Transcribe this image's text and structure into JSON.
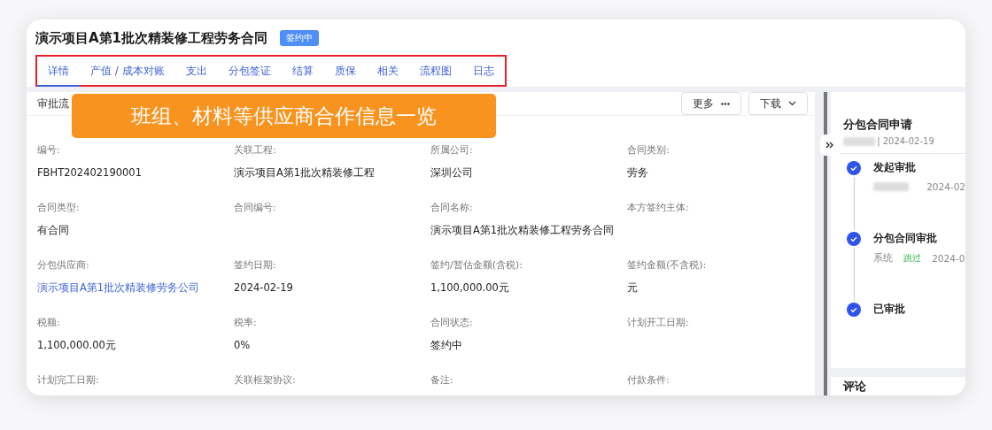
{
  "title": "演示项目A第1批次精装修工程劳务合同",
  "status_badge": "签约中",
  "tabs": [
    {
      "label": "详情",
      "selected": true
    },
    {
      "label": "产值 / 成本对账",
      "selected": false
    },
    {
      "label": "支出",
      "selected": false
    },
    {
      "label": "分包签证",
      "selected": false
    },
    {
      "label": "结算",
      "selected": false
    },
    {
      "label": "质保",
      "selected": false
    },
    {
      "label": "相关",
      "selected": false
    },
    {
      "label": "流程图",
      "selected": false
    },
    {
      "label": "日志",
      "selected": false
    }
  ],
  "panel": {
    "heading": "审批流",
    "buttons": [
      {
        "label": "更多",
        "kind": "more"
      },
      {
        "label": "下载",
        "kind": "dropdown"
      }
    ]
  },
  "fields": [
    {
      "label": "编号:",
      "value": "FBHT202402190001",
      "kind": "text"
    },
    {
      "label": "关联工程:",
      "value": "演示项目A第1批次精装修工程",
      "kind": "text"
    },
    {
      "label": "所属公司:",
      "value": "深圳公司",
      "kind": "text"
    },
    {
      "label": "合同类别:",
      "value": "劳务",
      "kind": "text"
    },
    {
      "label": "合同类型:",
      "value": "有合同",
      "kind": "text"
    },
    {
      "label": "合同编号:"
    },
    {
      "label": "合同名称:",
      "value": "演示项目A第1批次精装修工程劳务合同",
      "kind": "text"
    },
    {
      "label": "本方签约主体:"
    },
    {
      "label": "分包供应商:",
      "value": "演示项目A第1批次精装修劳务公司",
      "kind": "link"
    },
    {
      "label": "签约日期:",
      "value": "2024-02-19",
      "kind": "text"
    },
    {
      "label": "签约/暂估金额(含税):",
      "value": "1,100,000.00元",
      "kind": "text"
    },
    {
      "label": "签约金额(不含税):",
      "value": "元",
      "kind": "text"
    },
    {
      "label": "税额:",
      "value": "1,100,000.00元",
      "kind": "text"
    },
    {
      "label": "税率:",
      "value": "0%",
      "kind": "text"
    },
    {
      "label": "合同状态:",
      "value": "签约中",
      "kind": "text"
    },
    {
      "label": "计划开工日期:"
    },
    {
      "label": "计划完工日期:"
    },
    {
      "label": "关联框架协议:"
    },
    {
      "label": "备注:"
    },
    {
      "label": "付款条件:"
    }
  ],
  "approval": {
    "title": "分包合同申请",
    "meta": "| 2024-02-19",
    "meta_blurred": true,
    "steps": [
      {
        "title": "发起审批",
        "done": true,
        "person_blurred": true,
        "date": "2024-02"
      },
      {
        "title": "分包合同审批",
        "done": true,
        "person": "系统",
        "result": "跳过",
        "date": "2024-0"
      },
      {
        "title": "已审批",
        "done": true
      }
    ]
  },
  "comments": {
    "title": "评论"
  },
  "banner": "班组、材料等供应商合作信息一览"
}
